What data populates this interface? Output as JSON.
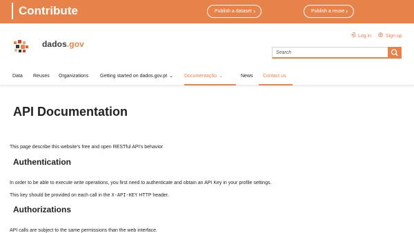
{
  "topbar": {
    "title": "Contribute",
    "publish_dataset": "Publish a dataset",
    "publish_reuse": "Publish a reuse",
    "chevron": "›"
  },
  "header": {
    "brand_name": "dados",
    "brand_tld": ".gov",
    "login": "Log in",
    "signup": "Sign up",
    "search_placeholder": "Search"
  },
  "nav": {
    "items": [
      {
        "label": "Data"
      },
      {
        "label": "Reuses"
      },
      {
        "label": "Organizations"
      },
      {
        "label": "Getting started on dados.gov.pt"
      },
      {
        "label": "Documentação"
      },
      {
        "label": "News"
      },
      {
        "label": "Contact us"
      }
    ],
    "dropdown_glyph": "⌄"
  },
  "content": {
    "title": "API Documentation",
    "intro": "This page describe this website's free and open RESTful API's behavior",
    "auth_heading": "Authentication",
    "auth_p1": "In order to be able to execute write operations, you first need to authenticate and obtain an API Key in your profile settings.",
    "auth_p2_a": "This key should be provided on each call in the ",
    "auth_p2_code": "X-API-KEY",
    "auth_p2_b": " HTTP header.",
    "authz_heading": "Authorizations",
    "authz_p1": "API calls are subject to the same permissions than the web interface."
  },
  "colors": {
    "accent": "#e7834a"
  },
  "icons": {
    "login": "login-icon",
    "signup": "user-add-icon",
    "search": "search-icon",
    "logo": "logo-icon"
  }
}
